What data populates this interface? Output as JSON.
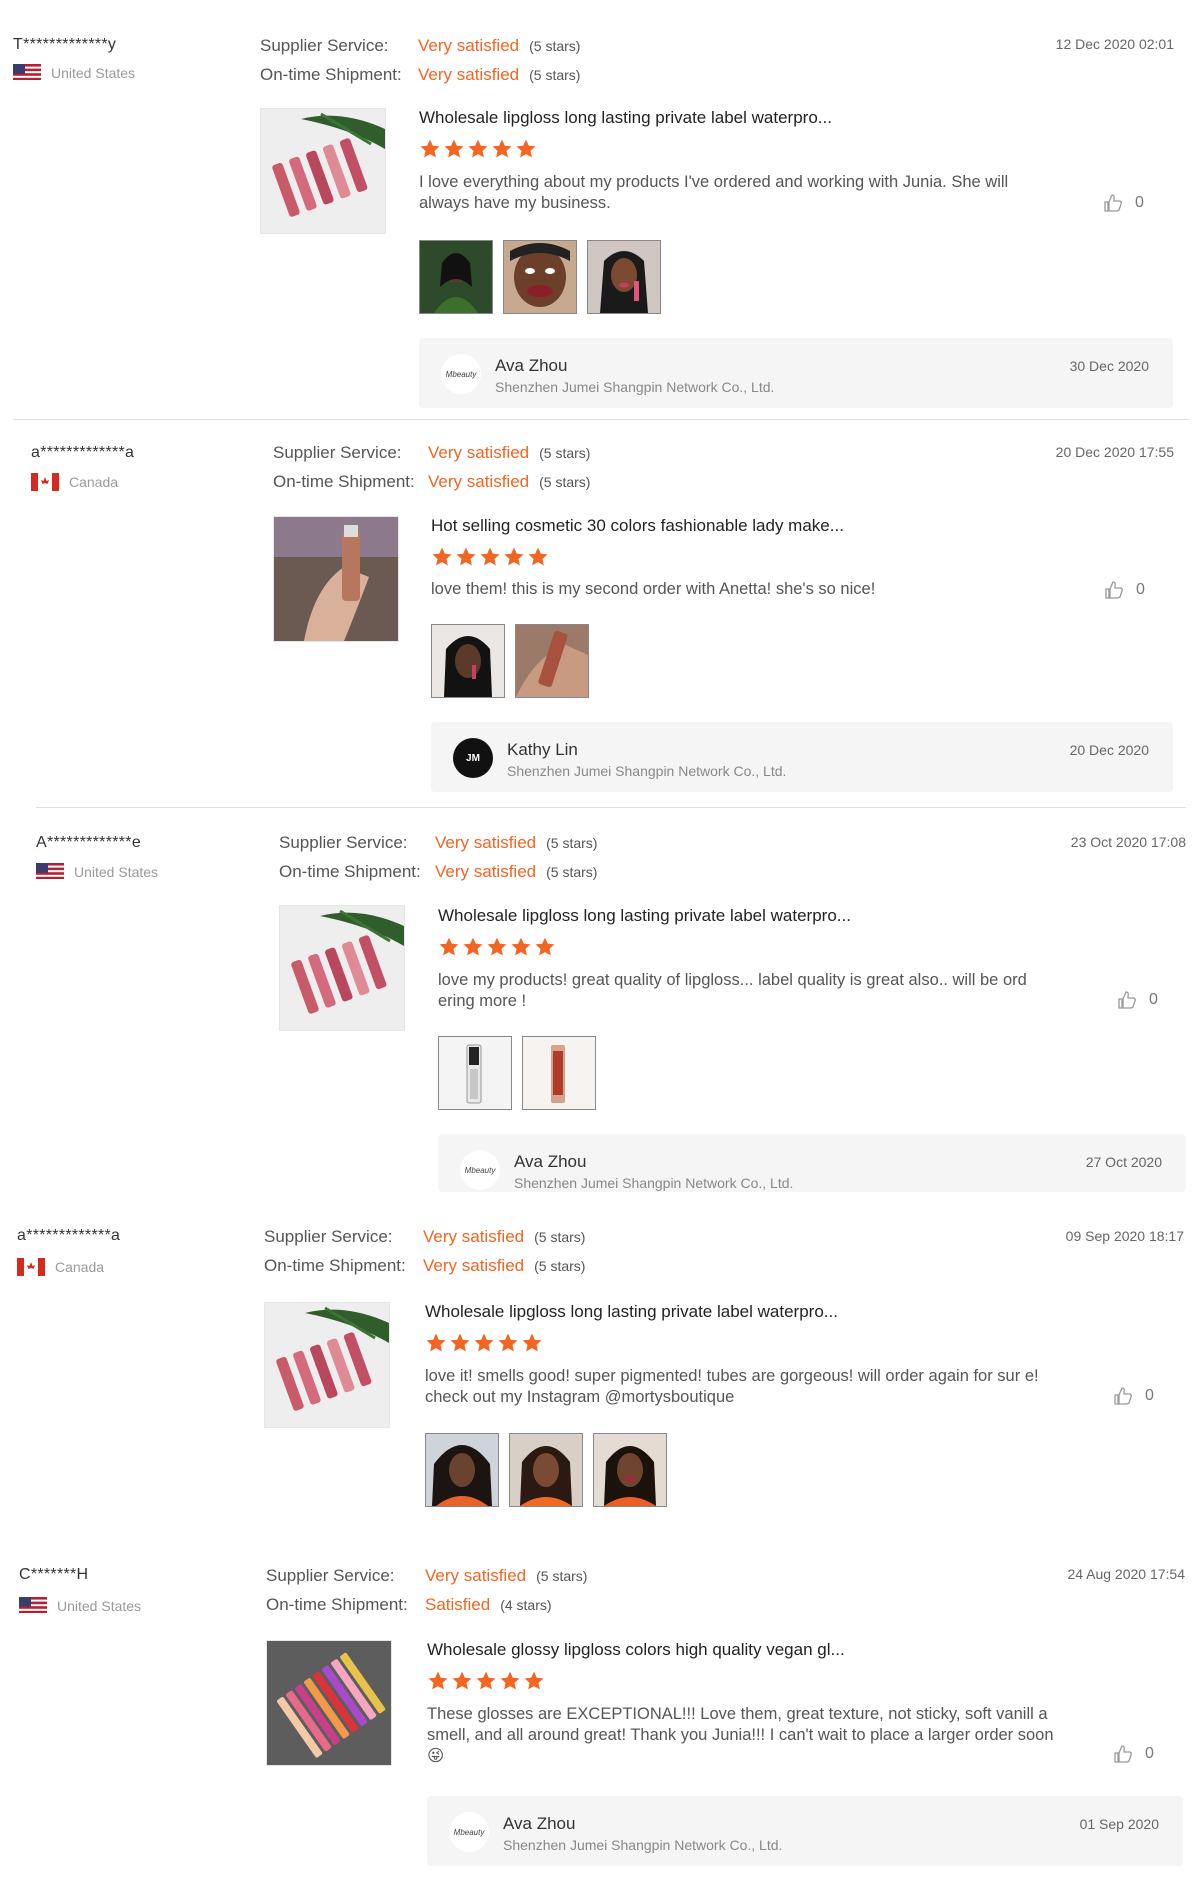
{
  "labels": {
    "supplier_service": "Supplier Service:",
    "ontime_shipment": "On-time Shipment:"
  },
  "reviews": [
    {
      "buyer": "T*************y",
      "country": "United States",
      "flag": "us",
      "supplier_rating": "Very satisfied",
      "supplier_stars": "(5 stars)",
      "shipment_rating": "Very satisfied",
      "shipment_stars": "(5 stars)",
      "date": "12 Dec 2020 02:01",
      "product_title": "Wholesale lipgloss long lasting private label waterpro...",
      "product_thumb": "lipgloss-tubes-with-palm-leaf",
      "rating": 5,
      "text": "I love everything about my products I've ordered and working with Junia. She will always have my business.",
      "likes": "0",
      "photos": [
        "customer-photo-woman-green-top",
        "customer-photo-woman-lips",
        "customer-photo-woman-selfie"
      ],
      "reply": {
        "name": "Ava Zhou",
        "company": "Shenzhen Jumei Shangpin Network Co., Ltd.",
        "date": "30 Dec 2020",
        "avatar": "Mbeauty"
      }
    },
    {
      "buyer": "a*************a",
      "country": "Canada",
      "flag": "ca",
      "supplier_rating": "Very satisfied",
      "supplier_stars": "(5 stars)",
      "shipment_rating": "Very satisfied",
      "shipment_stars": "(5 stars)",
      "date": "20 Dec 2020 17:55",
      "product_title": "Hot selling cosmetic 30 colors fashionable lady make...",
      "product_thumb": "hand-holding-lipgloss",
      "rating": 5,
      "text": "love them! this is my second order with Anetta! she's so nice!",
      "likes": "0",
      "photos": [
        "customer-photo-woman-applying",
        "customer-photo-lipgloss-closeup"
      ],
      "reply": {
        "name": "Kathy Lin",
        "company": "Shenzhen Jumei Shangpin Network Co., Ltd.",
        "date": "20 Dec 2020",
        "avatar": "JM"
      }
    },
    {
      "buyer": "A*************e",
      "country": "United States",
      "flag": "us",
      "supplier_rating": "Very satisfied",
      "supplier_stars": "(5 stars)",
      "shipment_rating": "Very satisfied",
      "shipment_stars": "(5 stars)",
      "date": "23 Oct 2020 17:08",
      "product_title": "Wholesale lipgloss long lasting private label waterpro...",
      "product_thumb": "lipgloss-tubes-with-palm-leaf",
      "rating": 5,
      "text": "love my products! great quality of lipgloss... label quality is great also.. will be ord ering more !",
      "likes": "0",
      "photos": [
        "customer-photo-clear-tube",
        "customer-photo-red-tube"
      ],
      "reply": {
        "name": "Ava Zhou",
        "company": "Shenzhen Jumei Shangpin Network Co., Ltd.",
        "date": "27 Oct 2020",
        "avatar": "Mbeauty"
      }
    },
    {
      "buyer": "a*************a",
      "country": "Canada",
      "flag": "ca",
      "supplier_rating": "Very satisfied",
      "supplier_stars": "(5 stars)",
      "shipment_rating": "Very satisfied",
      "shipment_stars": "(5 stars)",
      "date": "09 Sep 2020 18:17",
      "product_title": "Wholesale lipgloss long lasting private label waterpro...",
      "product_thumb": "lipgloss-tubes-with-palm-leaf",
      "rating": 5,
      "text": "love it! smells good! super pigmented! tubes are gorgeous! will order again for sur e! check out my Instagram @mortysboutique",
      "likes": "0",
      "photos": [
        "customer-photo-woman-curly-hair",
        "customer-photo-woman-orange-top",
        "customer-photo-woman-smiling"
      ],
      "reply": null
    },
    {
      "buyer": "C*******H",
      "country": "United States",
      "flag": "us",
      "supplier_rating": "Very satisfied",
      "supplier_stars": "(5 stars)",
      "shipment_rating": "Satisfied",
      "shipment_stars": "(4 stars)",
      "date": "24 Aug 2020 17:54",
      "product_title": "Wholesale glossy lipgloss colors high quality vegan gl...",
      "product_thumb": "colorful-lipgloss-fan",
      "rating": 5,
      "text": "These glosses are EXCEPTIONAL!!! Love them, great texture, not sticky, soft vanill a smell, and all around great! Thank you Junia!!! I can't wait to place a larger order soon 😜",
      "likes": "0",
      "photos": [],
      "reply": {
        "name": "Ava Zhou",
        "company": "Shenzhen Jumei Shangpin Network Co., Ltd.",
        "date": "01 Sep 2020",
        "avatar": "Mbeauty"
      }
    }
  ]
}
